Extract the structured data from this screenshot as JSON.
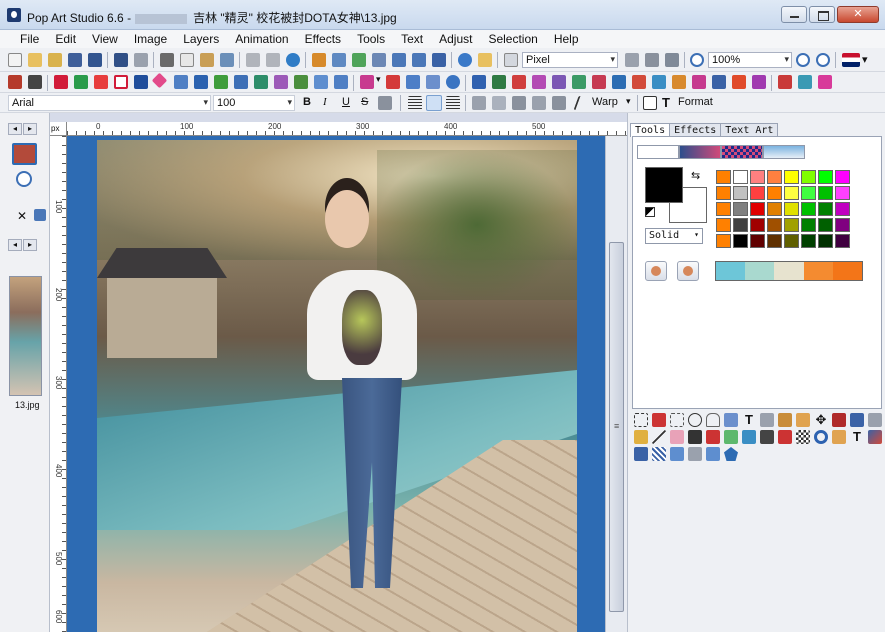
{
  "window": {
    "title_prefix": "Pop Art Studio 6.6 -",
    "title_suffix": "吉林 \"精灵\" 校花被封DOTA女神\\13.jpg"
  },
  "menu": [
    "File",
    "Edit",
    "View",
    "Image",
    "Layers",
    "Animation",
    "Effects",
    "Tools",
    "Text",
    "Adjust",
    "Selection",
    "Help"
  ],
  "toolbar": {
    "unit": "Pixel",
    "zoom": "100%",
    "font_name": "Arial",
    "font_size": "100",
    "bold": "B",
    "italic": "I",
    "underline": "U",
    "strike": "S",
    "warp_label": "Warp",
    "format_label": "Format"
  },
  "ruler": {
    "unit_label": "px",
    "top_ticks": [
      "0",
      "100",
      "200",
      "300",
      "400",
      "500"
    ],
    "left_ticks": [
      "100",
      "200",
      "300",
      "400",
      "500",
      "600"
    ]
  },
  "thumbnail": {
    "label": "13.jpg"
  },
  "right_panel": {
    "tabs": [
      "Tools",
      "Effects",
      "Text Art"
    ],
    "fill_style": "Solid",
    "palette": [
      "#ff8000",
      "#ffffff",
      "#ff8080",
      "#ff8040",
      "#ffff00",
      "#80ff00",
      "#00ff00",
      "#ff00ff",
      "#ff8000",
      "#c0c0c0",
      "#ff4040",
      "#ff8000",
      "#ffff40",
      "#40ff40",
      "#00c000",
      "#ff40ff",
      "#ff8000",
      "#808080",
      "#e00000",
      "#e08000",
      "#e0e000",
      "#00c000",
      "#008000",
      "#c000c0",
      "#ff8000",
      "#404040",
      "#a00000",
      "#a05000",
      "#a0a000",
      "#008000",
      "#006000",
      "#800080",
      "#ff8000",
      "#000000",
      "#600000",
      "#603000",
      "#606000",
      "#004000",
      "#003000",
      "#400040"
    ],
    "gradient": [
      "#6dc6d8",
      "#a9d9cf",
      "#e7e3cf",
      "#f48b30",
      "#f37518"
    ]
  }
}
